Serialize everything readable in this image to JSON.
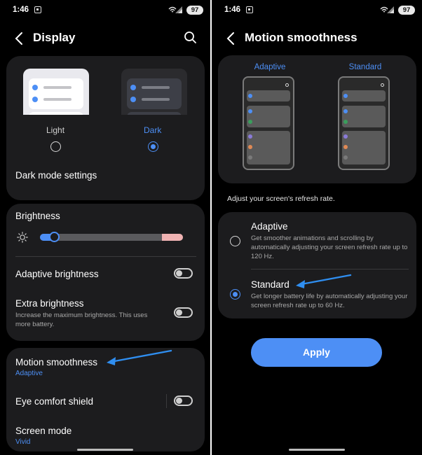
{
  "status": {
    "time": "1:46",
    "battery": "97"
  },
  "left": {
    "header": {
      "title": "Display"
    },
    "theme": {
      "light_label": "Light",
      "dark_label": "Dark",
      "selected": "Dark",
      "dark_mode_settings": "Dark mode settings"
    },
    "brightness": {
      "title": "Brightness",
      "level": 0.1,
      "adaptive_label": "Adaptive brightness",
      "adaptive_on": false,
      "extra_label": "Extra brightness",
      "extra_desc": "Increase the maximum brightness. This uses more battery.",
      "extra_on": false
    },
    "display_items": {
      "motion_label": "Motion smoothness",
      "motion_value": "Adaptive",
      "eye_label": "Eye comfort shield",
      "eye_on": false,
      "screen_mode_label": "Screen mode",
      "screen_mode_value": "Vivid"
    }
  },
  "right": {
    "header": {
      "title": "Motion smoothness"
    },
    "preview": {
      "adaptive_label": "Adaptive",
      "standard_label": "Standard"
    },
    "hint": "Adjust your screen's refresh rate.",
    "options": [
      {
        "title": "Adaptive",
        "desc": "Get smoother animations and scrolling by automatically adjusting your screen refresh rate up to 120 Hz.",
        "selected": false
      },
      {
        "title": "Standard",
        "desc": "Get longer battery life by automatically adjusting your screen refresh rate up to 60 Hz.",
        "selected": true
      }
    ],
    "apply_label": "Apply"
  },
  "colors": {
    "accent": "#4d8ff5",
    "card": "#1c1c1e",
    "arrow": "#2f8ef0"
  }
}
